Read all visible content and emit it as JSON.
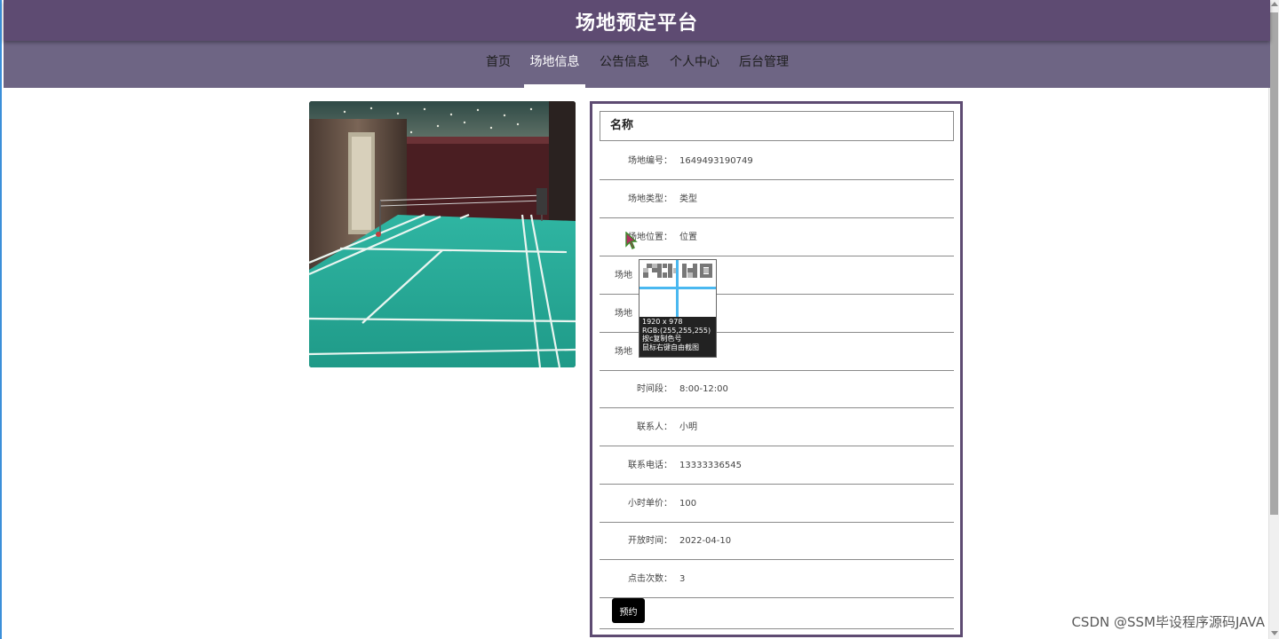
{
  "header": {
    "title": "场地预定平台"
  },
  "nav": {
    "items": [
      {
        "label": "首页"
      },
      {
        "label": "场地信息"
      },
      {
        "label": "公告信息"
      },
      {
        "label": "个人中心"
      },
      {
        "label": "后台管理"
      }
    ],
    "active_index": 1
  },
  "detail": {
    "title": "名称",
    "rows": [
      {
        "label": "场地编号：",
        "value": "1649493190749"
      },
      {
        "label": "场地类型：",
        "value": "类型"
      },
      {
        "label": "场地位置：",
        "value": "位置"
      },
      {
        "label": "场地",
        "value": ""
      },
      {
        "label": "场地",
        "value": ""
      },
      {
        "label": "场地",
        "value": ""
      },
      {
        "label": "时间段：",
        "value": "8:00-12:00"
      },
      {
        "label": "联系人：",
        "value": "小明"
      },
      {
        "label": "联系电话：",
        "value": "13333336545"
      },
      {
        "label": "小时单价：",
        "value": "100"
      },
      {
        "label": "开放时间：",
        "value": "2022-04-10"
      },
      {
        "label": "点击次数：",
        "value": "3"
      }
    ],
    "book_label": "预约"
  },
  "picker": {
    "line1": "1920 x 978",
    "line2": "RGB:(255,255,255)",
    "line3": "按c复制色号",
    "line4": "鼠标右键自由截图"
  },
  "watermark": "CSDN @SSM毕设程序源码JAVA",
  "colors": {
    "header_bg": "#5e4b72",
    "nav_bg": "#6e6584",
    "card_border": "#5e4b72",
    "button_bg": "#000000"
  }
}
